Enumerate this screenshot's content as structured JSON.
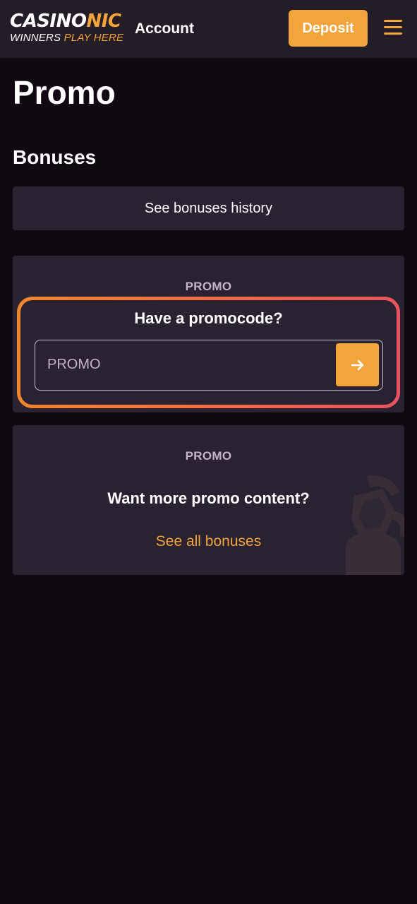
{
  "brand": {
    "logo_word_a": "CASINO",
    "logo_word_b": "NIC",
    "tagline_a": "WINNERS ",
    "tagline_b": "PLAY HERE"
  },
  "header": {
    "account_label": "Account",
    "deposit_label": "Deposit",
    "menu_icon": "hamburger-menu-icon"
  },
  "page": {
    "title": "Promo",
    "section_title": "Bonuses"
  },
  "bonuses": {
    "history_button_label": "See bonuses history"
  },
  "promo_code_card": {
    "label": "PROMO",
    "question": "Have a promocode?",
    "input_placeholder": "PROMO",
    "input_value": "",
    "submit_icon": "arrow-right-icon"
  },
  "promo_content_card": {
    "label": "PROMO",
    "question": "Want more promo content?",
    "link_label": "See all bonuses",
    "decoration_icon": "trophy-icon"
  },
  "colors": {
    "background": "#110912",
    "header": "#241c26",
    "card": "#2a2230",
    "accent": "#f3a43b",
    "label": "#c4b3c7",
    "highlight_gradient": [
      "#f0862e",
      "#ef6a48",
      "#e5545e"
    ]
  }
}
